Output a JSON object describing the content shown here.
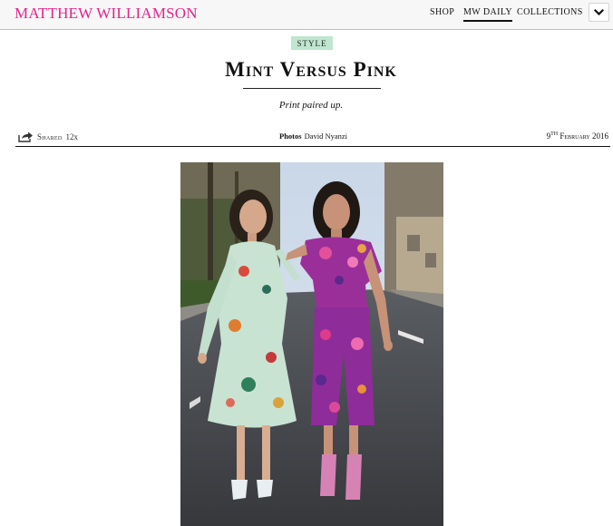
{
  "header": {
    "brand": "MATTHEW WILLIAMSON",
    "nav": {
      "shop": "SHOP",
      "daily": "MW DAILY",
      "collections": "COLLECTIONS"
    },
    "menu_icon": "chevron-down-icon"
  },
  "article": {
    "category": "STYLE",
    "title": "Mint Versus Pink",
    "subtitle": "Print paired up.",
    "share_label": "Shared",
    "share_count": "12x",
    "share_icon": "share-icon",
    "credit_label": "Photos",
    "credit_name": "David Nyanzi",
    "date_day": "9",
    "date_suffix": "TH",
    "date_rest": "February 2016"
  },
  "colors": {
    "brand": "#e6218c",
    "tag_bg": "#bfe6cf",
    "rule": "#111111"
  }
}
